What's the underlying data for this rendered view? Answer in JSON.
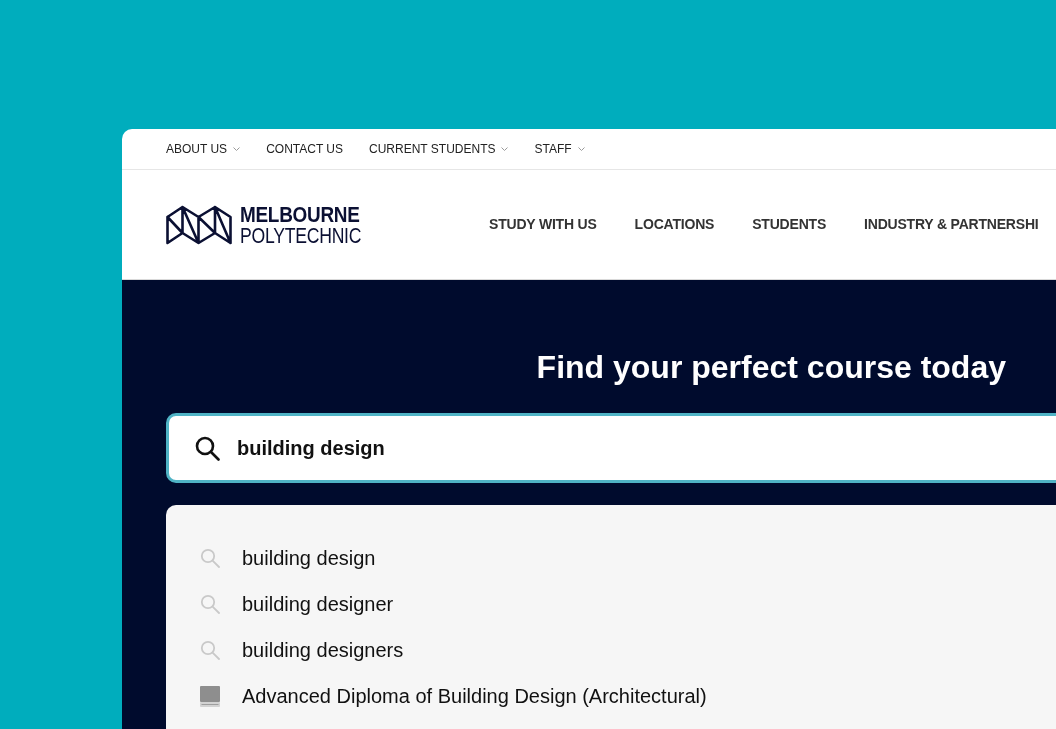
{
  "utility_nav": [
    {
      "label": "ABOUT US",
      "has_dropdown": true
    },
    {
      "label": "CONTACT US",
      "has_dropdown": false
    },
    {
      "label": "CURRENT STUDENTS",
      "has_dropdown": true
    },
    {
      "label": "STAFF",
      "has_dropdown": true
    }
  ],
  "logo": {
    "line_1": "MELBOURNE",
    "line_2": "POLYTECHNIC"
  },
  "main_nav": [
    "STUDY WITH US",
    "LOCATIONS",
    "STUDENTS",
    "INDUSTRY & PARTNERSHI"
  ],
  "hero": {
    "heading": "Find your perfect course today"
  },
  "search": {
    "value": "building design"
  },
  "suggestions": [
    {
      "kind": "query",
      "text": "building design"
    },
    {
      "kind": "query",
      "text": "building designer"
    },
    {
      "kind": "query",
      "text": "building designers"
    },
    {
      "kind": "course",
      "text": "Advanced Diploma of Building Design (Architectural)"
    }
  ]
}
